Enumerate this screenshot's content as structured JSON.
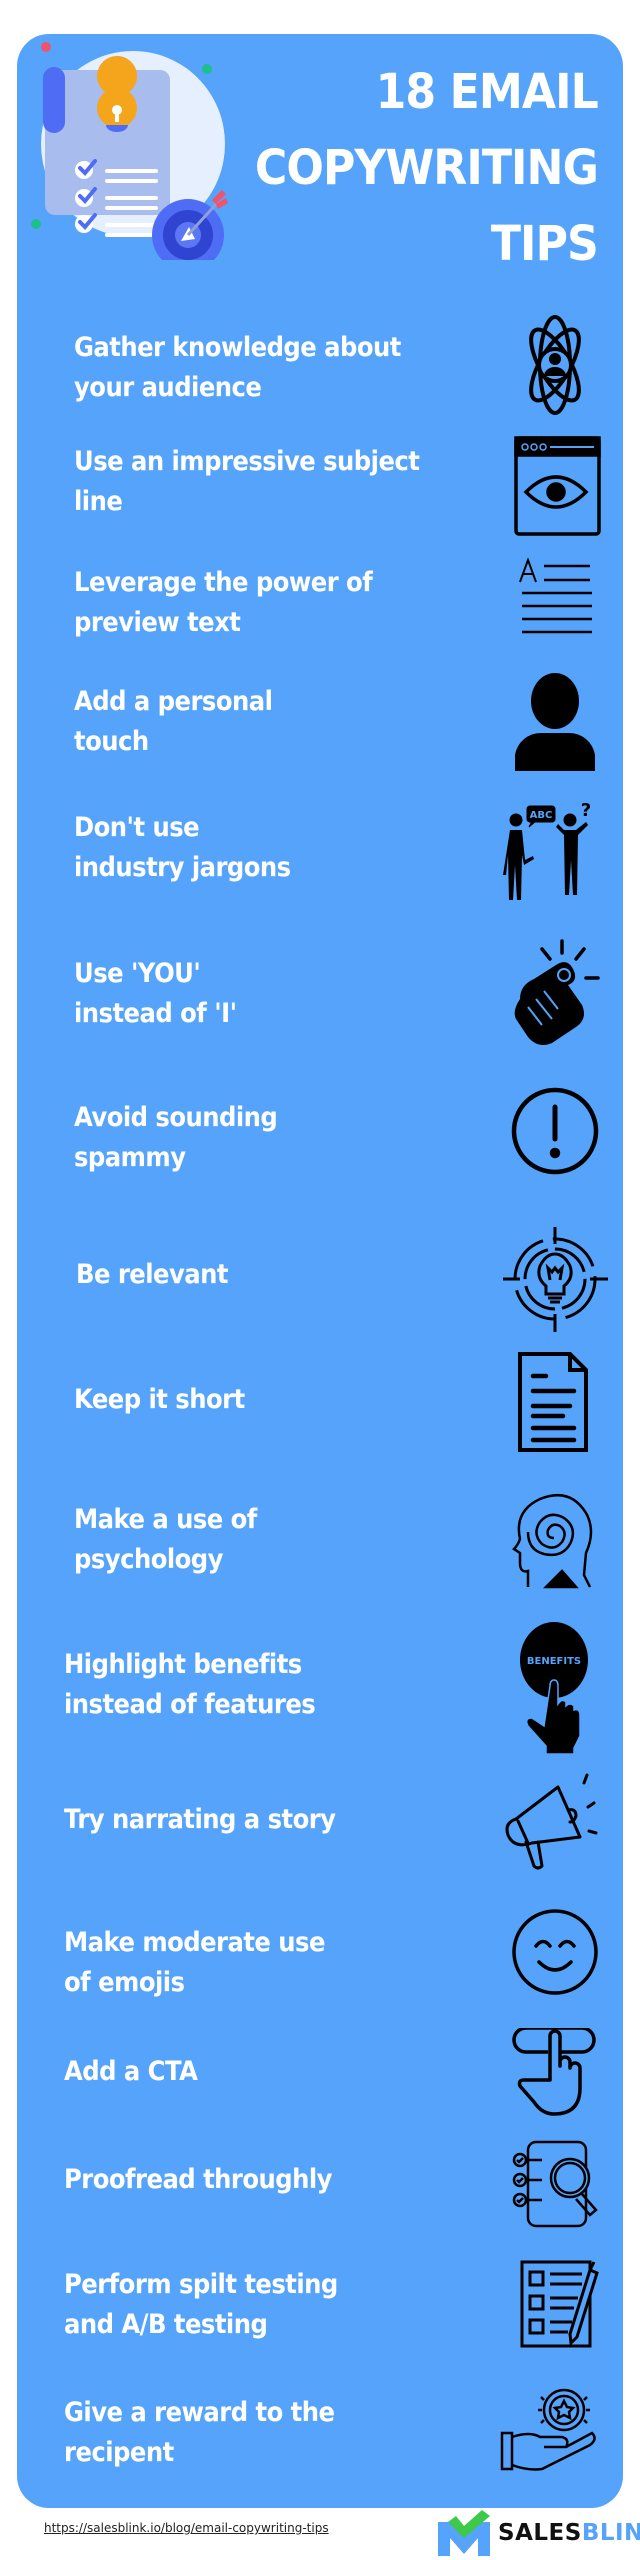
{
  "header": {
    "title_lines": [
      "18 EMAIL",
      "COPYWRITING",
      "TIPS"
    ],
    "illustration": "checklist-with-lightbulb-and-target-illustration"
  },
  "tips": [
    {
      "lines": [
        "Gather knowledge about",
        "your audience"
      ],
      "icon": "atom-person-icon"
    },
    {
      "lines": [
        "Use an impressive subject",
        "line"
      ],
      "icon": "browser-eye-icon"
    },
    {
      "lines": [
        "Leverage the power of",
        "preview text"
      ],
      "icon": "text-lines-icon"
    },
    {
      "lines": [
        "Add a personal",
        "touch"
      ],
      "icon": "user-icon"
    },
    {
      "lines": [
        "Don't use",
        "industry jargons"
      ],
      "icon": "people-talking-icon",
      "badge": "ABC",
      "question": "?"
    },
    {
      "lines": [
        "Use 'YOU'",
        "instead of 'I'"
      ],
      "icon": "pointing-hand-icon"
    },
    {
      "lines": [
        "Avoid sounding",
        "spammy"
      ],
      "icon": "exclamation-circle-icon"
    },
    {
      "lines": [
        "Be relevant"
      ],
      "icon": "lightbulb-target-icon"
    },
    {
      "lines": [
        "Keep it short"
      ],
      "icon": "document-icon"
    },
    {
      "lines": [
        "Make a use of",
        "psychology"
      ],
      "icon": "head-spiral-icon"
    },
    {
      "lines": [
        "Highlight benefits",
        "instead of features"
      ],
      "icon": "benefits-button-icon",
      "badge": "BENEFITS"
    },
    {
      "lines": [
        "Try narrating a story"
      ],
      "icon": "megaphone-icon"
    },
    {
      "lines": [
        "Make moderate use",
        "of emojis"
      ],
      "icon": "smiley-icon"
    },
    {
      "lines": [
        "Add a CTA"
      ],
      "icon": "click-button-icon"
    },
    {
      "lines": [
        "Proofread throughly"
      ],
      "icon": "checklist-magnifier-icon"
    },
    {
      "lines": [
        "Perform spilt testing",
        "and A/B testing"
      ],
      "icon": "form-pen-icon"
    },
    {
      "lines": [
        "Give a reward to the",
        "recipent"
      ],
      "icon": "hand-reward-icon"
    }
  ],
  "footer": {
    "url": "https://salesblink.io/blog/email-copywriting-tips",
    "brand_part1": "SALES",
    "brand_part2": "BLINK"
  },
  "colors": {
    "card": "#55a3fb",
    "text": "#ffffff",
    "icon": "#000000",
    "brand_green": "#3ec94a",
    "brand_blue": "#55a3fb"
  }
}
